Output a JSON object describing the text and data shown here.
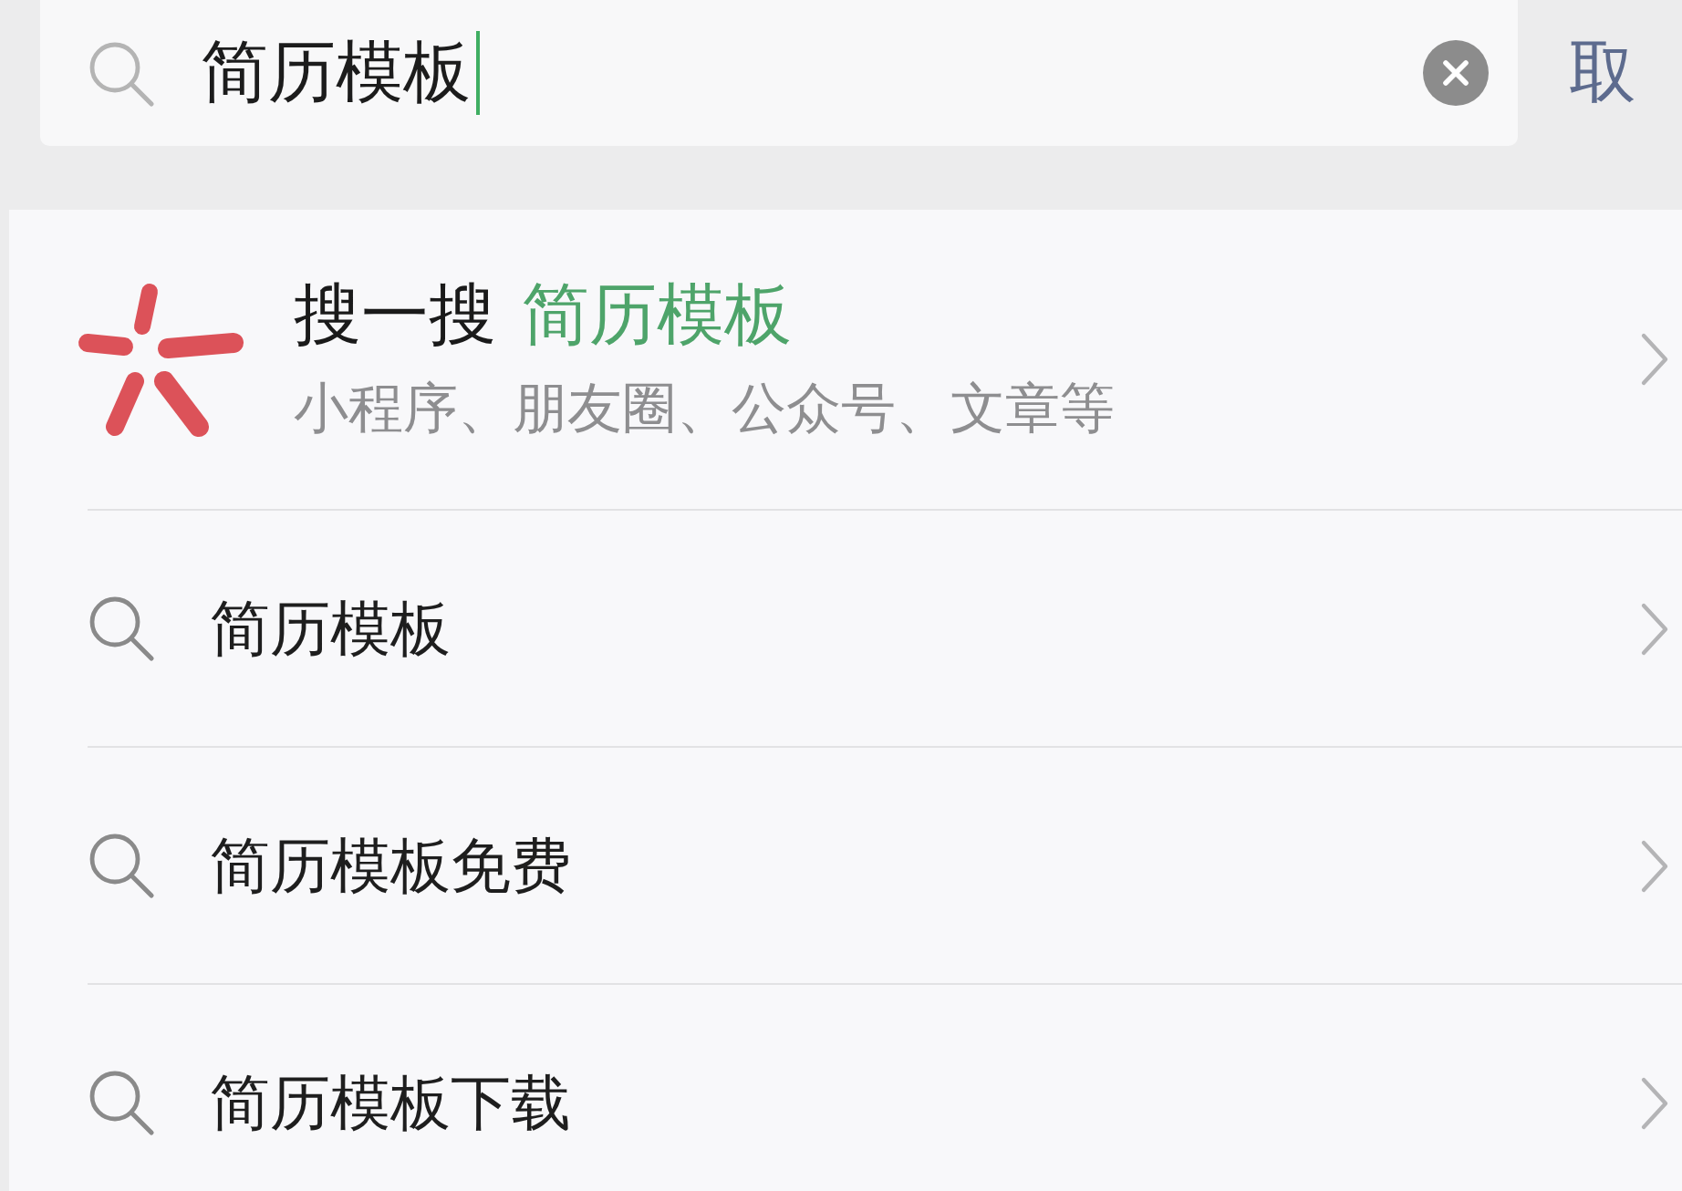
{
  "search_bar": {
    "query": "简历模板",
    "focused": true,
    "cancel_label": "取"
  },
  "results": [
    {
      "kind": "service",
      "title": "搜一搜",
      "highlight": "简历模板",
      "subtitle": "小程序、朋友圈、公众号、文章等"
    },
    {
      "kind": "suggestion",
      "text": "简历模板"
    },
    {
      "kind": "suggestion",
      "text": "简历模板免费"
    },
    {
      "kind": "suggestion",
      "text": "简历模板下载"
    }
  ]
}
